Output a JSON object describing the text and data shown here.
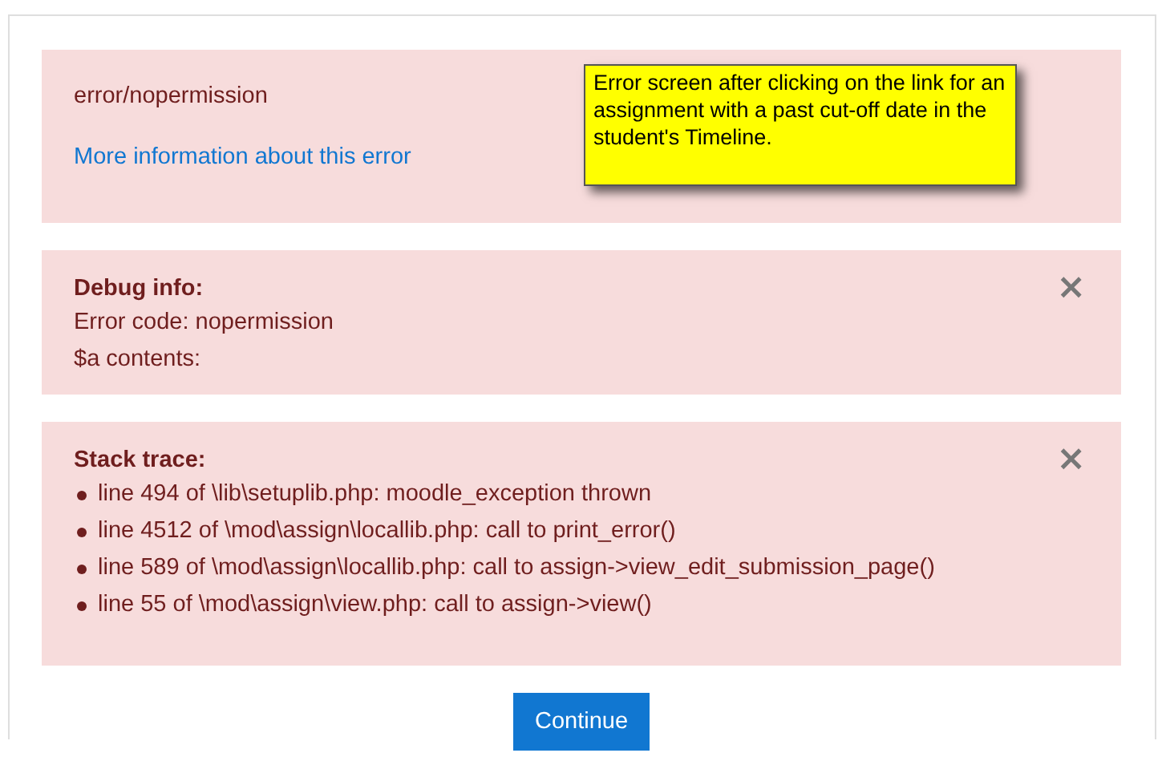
{
  "error_box": {
    "error_key": "error/nopermission",
    "link": "More information about this error"
  },
  "callout": {
    "text": "Error screen after clicking on the link for an assignment with a past cut-off date in the student's Timeline."
  },
  "debug_box": {
    "title": "Debug info:",
    "close": "×",
    "lines": [
      "Error code: nopermission",
      "$a contents:"
    ]
  },
  "stack_box": {
    "title": "Stack trace:",
    "close": "×",
    "items": [
      "line 494 of \\lib\\setuplib.php: moodle_exception thrown",
      "line 4512 of \\mod\\assign\\locallib.php: call to print_error()",
      "line 589 of \\mod\\assign\\locallib.php: call to assign->view_edit_submission_page()",
      "line 55 of \\mod\\assign\\view.php: call to assign->view()"
    ]
  },
  "continue_button": "Continue"
}
